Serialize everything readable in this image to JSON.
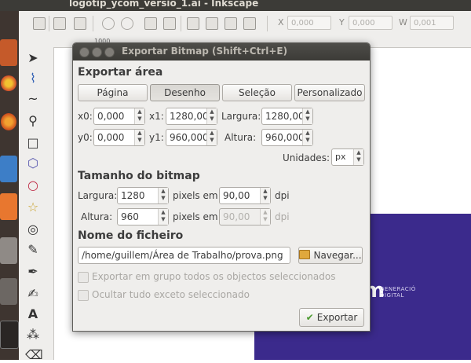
{
  "window": {
    "title": "logotip_ycom_versio_1.ai - Inkscape"
  },
  "commands_bar": {
    "x_label": "X",
    "x_value": "0,000",
    "y_label": "Y",
    "y_value": "0,000",
    "w_label": "W",
    "w_value": "0,001"
  },
  "ruler": {
    "tick": "1000"
  },
  "canvas": {
    "logo_letter": "m",
    "logo_text_line1": "GENERACIÓ",
    "logo_text_line2": "DIGITAL"
  },
  "dialog": {
    "title": "Exportar Bitmap (Shift+Ctrl+E)",
    "export_area": {
      "heading": "Exportar área",
      "buttons": {
        "page": "Página",
        "drawing": "Desenho",
        "selection": "Seleção",
        "custom": "Personalizado"
      },
      "selected": "drawing",
      "x0_label": "x0:",
      "x0": "0,000",
      "x1_label": "x1:",
      "x1": "1280,00",
      "width_label": "Largura:",
      "width": "1280,00",
      "y0_label": "y0:",
      "y0": "0,000",
      "y1_label": "y1:",
      "y1": "960,000",
      "height_label": "Altura:",
      "height": "960,000",
      "units_label": "Unidades:",
      "units": "px"
    },
    "bitmap_size": {
      "heading": "Tamanho do bitmap",
      "width_label": "Largura:",
      "width": "1280",
      "width_unit": "pixels em",
      "dpi_x": "90,00",
      "dpi_x_unit": "dpi",
      "height_label": "Altura:",
      "height": "960",
      "height_unit": "pixels em",
      "dpi_y": "90,00",
      "dpi_y_unit": "dpi"
    },
    "filename": {
      "heading": "Nome do ficheiro",
      "path": "/home/guillem/Área de Trabalho/prova.png",
      "browse_label": "Navegar..."
    },
    "options": {
      "batch_export": "Exportar em grupo todos os objectos seleccionados",
      "hide_unselected": "Ocultar tudo exceto seleccionado"
    },
    "export_button": "Exportar"
  },
  "colors": {
    "accent_purple": "#3b2a8c",
    "dialog_bg": "#efeeec",
    "titlebar": "#3c3b37"
  }
}
